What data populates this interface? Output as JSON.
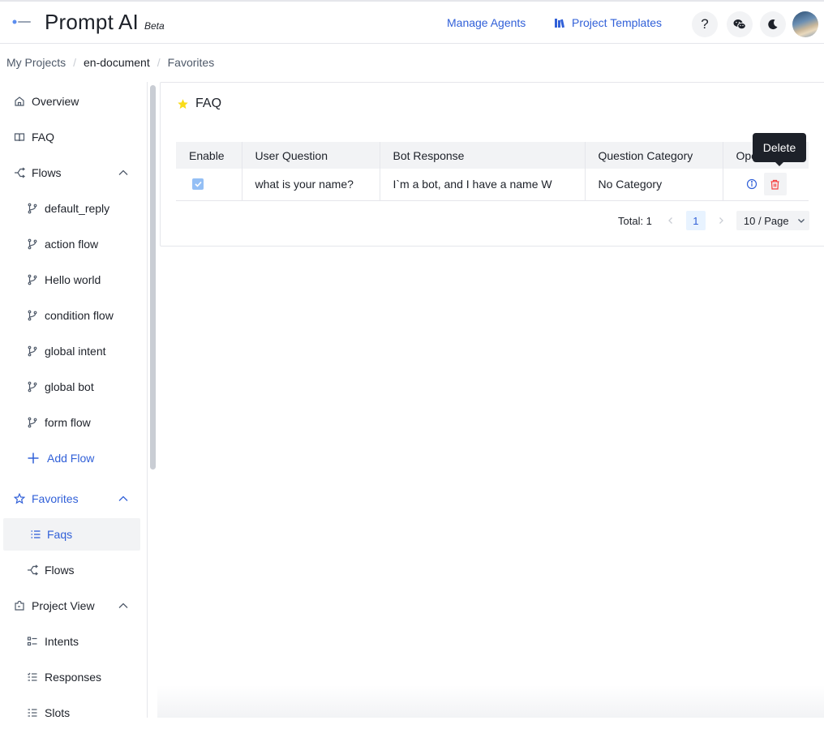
{
  "header": {
    "brand": "Prompt AI",
    "beta": "Beta",
    "manage_agents": "Manage Agents",
    "project_templates": "Project Templates",
    "help": "?"
  },
  "breadcrumb": [
    "My Projects",
    "en-document",
    "Favorites"
  ],
  "sidebar": {
    "overview": "Overview",
    "faq": "FAQ",
    "flows": "Flows",
    "flow_items": [
      "default_reply",
      "action flow",
      "Hello world",
      "condition flow",
      "global intent",
      "global bot",
      "form flow"
    ],
    "add_flow": "Add Flow",
    "favorites": "Favorites",
    "favorite_items": [
      "Faqs",
      "Flows"
    ],
    "project_view": "Project View",
    "project_view_items": [
      "Intents",
      "Responses",
      "Slots"
    ]
  },
  "main": {
    "title": "FAQ",
    "columns": [
      "Enable",
      "User Question",
      "Bot Response",
      "Question Category",
      "Ope"
    ],
    "rows": [
      {
        "question": "what is your name?",
        "response": "I`m a bot, and I have a name W",
        "category": "No Category",
        "enabled": true
      }
    ],
    "tooltip": "Delete",
    "pagination": {
      "total": "Total: 1",
      "page": "1",
      "page_size": "10 / Page"
    }
  },
  "colors": {
    "accent": "#3160d8",
    "danger": "#f53f3f",
    "star": "#fadc19"
  }
}
